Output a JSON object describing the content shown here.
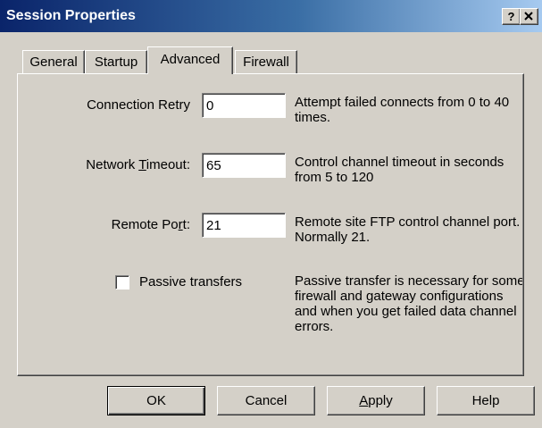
{
  "window": {
    "title": "Session Properties",
    "help_label": "?",
    "close_label": "X"
  },
  "tabs": [
    {
      "label": "General"
    },
    {
      "label": "Startup"
    },
    {
      "label": "Advanced",
      "active": true
    },
    {
      "label": "Firewall"
    }
  ],
  "advanced": {
    "connection_retry": {
      "label": "Connection Retry",
      "value": "0",
      "description": "Attempt failed connects from 0 to 40 times."
    },
    "network_timeout": {
      "label_before": "Network ",
      "label_underlined": "T",
      "label_after": "imeout:",
      "value": "65",
      "description": "Control channel timeout in seconds from 5 to 120"
    },
    "remote_port": {
      "label_before": "Remote Po",
      "label_underlined": "r",
      "label_after": "t:",
      "value": "21",
      "description": "Remote site FTP control channel port. Normally 21."
    },
    "passive": {
      "label": "Passive transfers",
      "checked": false,
      "description": "Passive transfer is necessary for some firewall and gateway configurations and when you get failed data channel errors."
    }
  },
  "buttons": {
    "ok": "OK",
    "cancel": "Cancel",
    "apply_underlined": "A",
    "apply_rest": "pply",
    "help": "Help"
  }
}
